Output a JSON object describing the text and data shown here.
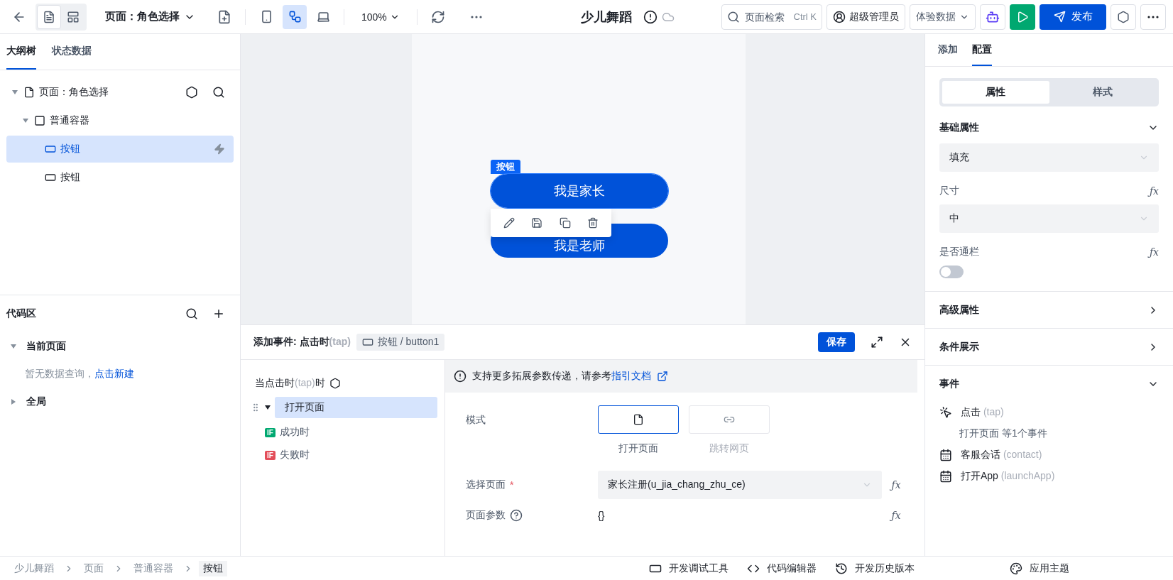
{
  "toolbar": {
    "view_modes": [
      {
        "kind": "outline",
        "selected": true
      },
      {
        "kind": "layout",
        "selected": false
      }
    ],
    "page_select": "页面：角色选择",
    "devices": [
      {
        "kind": "mobile",
        "selected": false
      },
      {
        "kind": "miniprogram",
        "selected": true
      },
      {
        "kind": "desktop",
        "selected": false
      }
    ],
    "zoom": "100%",
    "app_title": "少儿舞蹈",
    "search": {
      "placeholder": "页面检索",
      "shortcut": "Ctrl K"
    },
    "user": "超级管理员",
    "data_select": "体验数据",
    "publish": "发布"
  },
  "left_panel": {
    "tabs": [
      {
        "label": "大纲树",
        "selected": true
      },
      {
        "label": "状态数据",
        "selected": false
      }
    ],
    "tree": [
      {
        "label": "页面：角色选择",
        "kind": "page",
        "selected": false,
        "expanded": true,
        "children": [
          {
            "label": "普通容器",
            "kind": "container",
            "selected": false,
            "expanded": true,
            "children": [
              {
                "label": "按钮",
                "kind": "button",
                "selected": true
              },
              {
                "label": "按钮",
                "kind": "button",
                "selected": false
              }
            ]
          }
        ]
      }
    ],
    "code_area": {
      "title": "代码区",
      "sections": [
        {
          "label": "当前页面",
          "expanded": true,
          "empty_text": "暂无数据查询，",
          "empty_link": "点击新建"
        },
        {
          "label": "全局",
          "expanded": false
        }
      ]
    }
  },
  "canvas": {
    "selection_tag": "按钮",
    "buttons": [
      {
        "label": "我是家长",
        "selected": true
      },
      {
        "label": "我是老师",
        "selected": false
      }
    ]
  },
  "event_panel": {
    "title": "添加事件: 点击时",
    "title_code": "(tap)",
    "component": "按钮 / button1",
    "save": "保存",
    "trigger": {
      "before": "当点击时",
      "code": "(tap)",
      "after": "时"
    },
    "actions": [
      {
        "label": "打开页面",
        "selected": true,
        "expanded": true,
        "children": [
          {
            "label": "成功时",
            "badge": "IF",
            "kind": "success",
            "selected": false
          },
          {
            "label": "失败时",
            "badge": "IF",
            "kind": "failure",
            "selected": false
          }
        ]
      }
    ],
    "notice": {
      "text": "支持更多拓展参数传递，请参考",
      "link": "指引文档"
    },
    "mode": {
      "label": "模式",
      "options": [
        {
          "label": "打开页面",
          "kind": "page",
          "selected": true
        },
        {
          "label": "跳转网页",
          "kind": "link",
          "selected": false
        }
      ]
    },
    "page_select": {
      "label": "选择页面",
      "required_mark": "*",
      "value": "家长注册(u_jia_chang_zhu_ce)",
      "formula": "ƒx"
    },
    "params": {
      "label": "页面参数",
      "value": "{}",
      "formula": "ƒx"
    }
  },
  "right_panel": {
    "tabs": [
      {
        "label": "添加",
        "selected": false
      },
      {
        "label": "配置",
        "selected": true
      }
    ],
    "segments": [
      {
        "label": "属性",
        "selected": true
      },
      {
        "label": "样式",
        "selected": false
      }
    ],
    "basic": {
      "title": "基础属性",
      "expanded": true,
      "fields": [
        {
          "kind": "select",
          "value": "填充"
        },
        {
          "kind": "select",
          "label": "尺寸",
          "formula": "ƒx",
          "value": "中"
        },
        {
          "kind": "switch",
          "label": "是否通栏",
          "formula": "ƒx",
          "on": false
        }
      ]
    },
    "collapsed_sections": [
      {
        "title": "高级属性",
        "expanded": false
      },
      {
        "title": "条件展示",
        "expanded": false
      }
    ],
    "events": {
      "title": "事件",
      "expanded": true,
      "items": [
        {
          "kind": "tap",
          "name": "点击",
          "code": "(tap)",
          "summary": "打开页面 等1个事件"
        },
        {
          "kind": "contact",
          "name": "客服会话",
          "code": "(contact)"
        },
        {
          "kind": "launch",
          "name": "打开App",
          "code": "(launchApp)"
        }
      ]
    }
  },
  "status_bar": {
    "breadcrumb": [
      "少儿舞蹈",
      "页面",
      "普通容器",
      "按钮"
    ],
    "tools": [
      {
        "kind": "debug",
        "label": "开发调试工具"
      },
      {
        "kind": "code",
        "label": "代码编辑器"
      },
      {
        "kind": "history",
        "label": "开发历史版本"
      }
    ],
    "theme": "应用主题"
  }
}
